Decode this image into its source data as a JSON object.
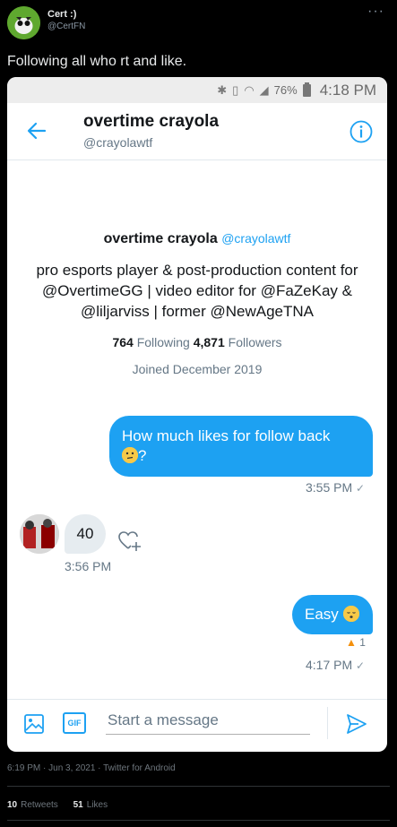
{
  "tweet": {
    "author_name": "Cert :)",
    "author_handle": "@CertFN",
    "text": "Following all who rt and like.",
    "timestamp": "6:19 PM · Jun 3, 2021 · Twitter for Android",
    "retweets_count": "10",
    "retweets_label": "Retweets",
    "likes_count": "51",
    "likes_label": "Likes"
  },
  "phone_status": {
    "battery": "76%",
    "time": "4:18 PM",
    "icons": [
      "bluetooth-icon",
      "vibrate-icon",
      "wifi-icon",
      "signal-icon",
      "battery-icon"
    ]
  },
  "dm": {
    "name": "overtime crayola",
    "handle": "@crayolawtf",
    "profile": {
      "name": "overtime crayola",
      "handle": "@crayolawtf",
      "bio": "pro esports player & post-production content for @OvertimeGG | video editor for @FaZeKay & @liljarviss | former @NewAgeTNA",
      "following_count": "764",
      "following_label": "Following",
      "followers_count": "4,871",
      "followers_label": "Followers",
      "joined": "Joined December 2019"
    },
    "messages": [
      {
        "direction": "outgoing",
        "text": "How much likes for follow back",
        "suffix": "?",
        "time": "3:55 PM"
      },
      {
        "direction": "incoming",
        "text": "40",
        "time": "3:56 PM"
      },
      {
        "direction": "outgoing",
        "text": "Easy",
        "time": "4:17 PM",
        "reaction_count": "1"
      }
    ],
    "composer_placeholder": "Start a message",
    "gif_label": "GIF"
  },
  "colors": {
    "accent": "#1da1f2",
    "background": "#000000",
    "muted": "#657786"
  }
}
